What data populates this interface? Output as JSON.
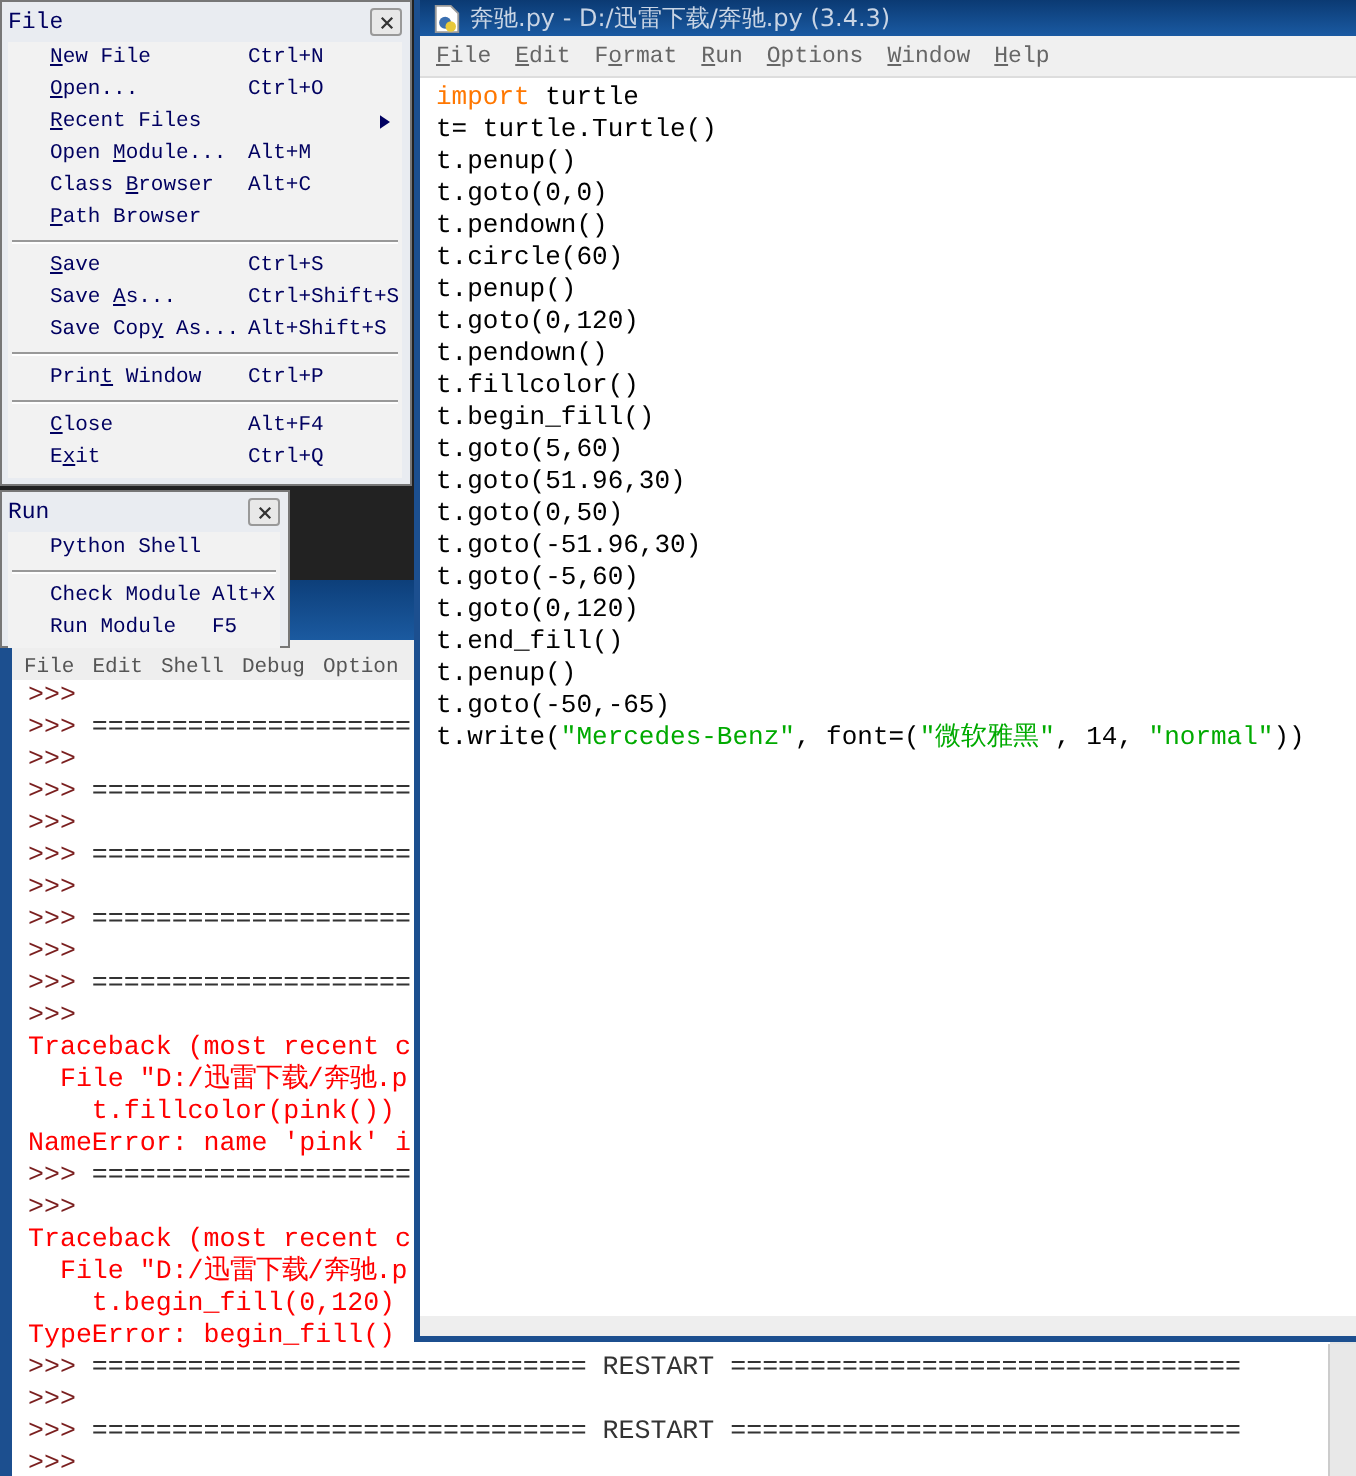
{
  "file_menu": {
    "title": "File",
    "items": [
      {
        "kind": "command",
        "key": "N",
        "after": "ew File",
        "shortcut": "Ctrl+N",
        "submenu": false
      },
      {
        "kind": "command",
        "key": "O",
        "after": "pen...",
        "shortcut": "Ctrl+O",
        "submenu": false
      },
      {
        "kind": "command",
        "key": "R",
        "after": "ecent Files",
        "submenu": true
      },
      {
        "kind": "command",
        "before": "Open ",
        "key": "M",
        "after": "odule...",
        "shortcut": "Alt+M",
        "submenu": false
      },
      {
        "kind": "command",
        "before": "Class ",
        "key": "B",
        "after": "rowser",
        "shortcut": "Alt+C",
        "submenu": false
      },
      {
        "kind": "command",
        "key": "P",
        "after": "ath Browser",
        "submenu": false
      },
      {
        "kind": "separator"
      },
      {
        "kind": "command",
        "key": "S",
        "after": "ave",
        "shortcut": "Ctrl+S",
        "submenu": false
      },
      {
        "kind": "command",
        "before": "Save ",
        "key": "A",
        "after": "s...",
        "shortcut": "Ctrl+Shift+S",
        "submenu": false
      },
      {
        "kind": "command",
        "before": "Save Cop",
        "key": "y",
        "after": " As...",
        "shortcut": "Alt+Shift+S",
        "submenu": false
      },
      {
        "kind": "separator"
      },
      {
        "kind": "command",
        "before": "Prin",
        "key": "t",
        "after": " Window",
        "shortcut": "Ctrl+P",
        "submenu": false
      },
      {
        "kind": "separator"
      },
      {
        "kind": "command",
        "key": "C",
        "after": "lose",
        "shortcut": "Alt+F4",
        "submenu": false
      },
      {
        "kind": "command",
        "before": "E",
        "key": "x",
        "after": "it",
        "shortcut": "Ctrl+Q",
        "submenu": false
      }
    ]
  },
  "run_menu": {
    "title": "Run",
    "items": [
      {
        "kind": "command",
        "label": "Python Shell"
      },
      {
        "kind": "separator"
      },
      {
        "kind": "command",
        "label": "Check Module",
        "shortcut": "Alt+X"
      },
      {
        "kind": "command",
        "label": "Run Module",
        "shortcut": "F5"
      }
    ]
  },
  "shell": {
    "menu": [
      "File",
      "Edit",
      "Shell",
      "Debug",
      "Option"
    ],
    "lines": [
      {
        "kind": "prompt",
        "prompt": ">>>"
      },
      {
        "kind": "prompt",
        "prompt": ">>>",
        "text": " ===================="
      },
      {
        "kind": "prompt",
        "prompt": ">>>"
      },
      {
        "kind": "prompt",
        "prompt": ">>>",
        "text": " ===================="
      },
      {
        "kind": "prompt",
        "prompt": ">>>"
      },
      {
        "kind": "prompt",
        "prompt": ">>>",
        "text": " ===================="
      },
      {
        "kind": "prompt",
        "prompt": ">>>"
      },
      {
        "kind": "prompt",
        "prompt": ">>>",
        "text": " ===================="
      },
      {
        "kind": "prompt",
        "prompt": ">>>"
      },
      {
        "kind": "prompt",
        "prompt": ">>>",
        "text": " ===================="
      },
      {
        "kind": "prompt",
        "prompt": ">>>"
      },
      {
        "kind": "error",
        "text": "Traceback (most recent c"
      },
      {
        "kind": "error",
        "text": "  File \"D:/迅雷下载/奔驰.p"
      },
      {
        "kind": "error",
        "text": "    t.fillcolor(pink())"
      },
      {
        "kind": "error",
        "text": "NameError: name 'pink' i"
      },
      {
        "kind": "prompt",
        "prompt": ">>>",
        "text": " ===================="
      },
      {
        "kind": "prompt",
        "prompt": ">>>"
      },
      {
        "kind": "error",
        "text": "Traceback (most recent c"
      },
      {
        "kind": "error",
        "text": "  File \"D:/迅雷下载/奔驰.p"
      },
      {
        "kind": "error",
        "text": "    t.begin_fill(0,120)"
      },
      {
        "kind": "error",
        "text": "TypeError: begin_fill()"
      },
      {
        "kind": "prompt",
        "prompt": ">>>",
        "text": " =============================== RESTART ================================"
      },
      {
        "kind": "prompt",
        "prompt": ">>>"
      },
      {
        "kind": "prompt",
        "prompt": ">>>",
        "text": " =============================== RESTART ================================"
      },
      {
        "kind": "prompt",
        "prompt": ">>>"
      }
    ]
  },
  "editor": {
    "title": "奔驰.py - D:/迅雷下载/奔驰.py (3.4.3)",
    "menu": [
      {
        "key": "F",
        "after": "ile"
      },
      {
        "key": "E",
        "after": "dit"
      },
      {
        "before": "F",
        "key": "o",
        "after": "rmat"
      },
      {
        "key": "R",
        "after": "un"
      },
      {
        "key": "O",
        "after": "ptions"
      },
      {
        "key": "W",
        "after": "indow"
      },
      {
        "key": "H",
        "after": "elp"
      }
    ],
    "code": [
      [
        {
          "kind": "keyword",
          "text": "import"
        },
        {
          "kind": "plain",
          "text": " turtle"
        }
      ],
      [
        {
          "kind": "plain",
          "text": "t= turtle.Turtle()"
        }
      ],
      [
        {
          "kind": "plain",
          "text": "t.penup()"
        }
      ],
      [
        {
          "kind": "plain",
          "text": "t.goto(0,0)"
        }
      ],
      [
        {
          "kind": "plain",
          "text": "t.pendown()"
        }
      ],
      [
        {
          "kind": "plain",
          "text": "t.circle(60)"
        }
      ],
      [
        {
          "kind": "plain",
          "text": "t.penup()"
        }
      ],
      [
        {
          "kind": "plain",
          "text": "t.goto(0,120)"
        }
      ],
      [
        {
          "kind": "plain",
          "text": "t.pendown()"
        }
      ],
      [
        {
          "kind": "plain",
          "text": "t.fillcolor()"
        }
      ],
      [
        {
          "kind": "plain",
          "text": "t.begin_fill()"
        }
      ],
      [
        {
          "kind": "plain",
          "text": "t.goto(5,60)"
        }
      ],
      [
        {
          "kind": "plain",
          "text": "t.goto(51.96,30)"
        }
      ],
      [
        {
          "kind": "plain",
          "text": "t.goto(0,50)"
        }
      ],
      [
        {
          "kind": "plain",
          "text": "t.goto(-51.96,30)"
        }
      ],
      [
        {
          "kind": "plain",
          "text": "t.goto(-5,60)"
        }
      ],
      [
        {
          "kind": "plain",
          "text": "t.goto(0,120)"
        }
      ],
      [
        {
          "kind": "plain",
          "text": "t.end_fill()"
        }
      ],
      [
        {
          "kind": "plain",
          "text": "t.penup()"
        }
      ],
      [
        {
          "kind": "plain",
          "text": "t.goto(-50,-65)"
        }
      ],
      [
        {
          "kind": "plain",
          "text": "t.write("
        },
        {
          "kind": "string",
          "text": "\"Mercedes-Benz\""
        },
        {
          "kind": "plain",
          "text": ", font=("
        },
        {
          "kind": "string",
          "text": "\"微软雅黑\""
        },
        {
          "kind": "plain",
          "text": ", 14, "
        },
        {
          "kind": "string",
          "text": "\"normal\""
        },
        {
          "kind": "plain",
          "text": "))"
        }
      ]
    ]
  }
}
